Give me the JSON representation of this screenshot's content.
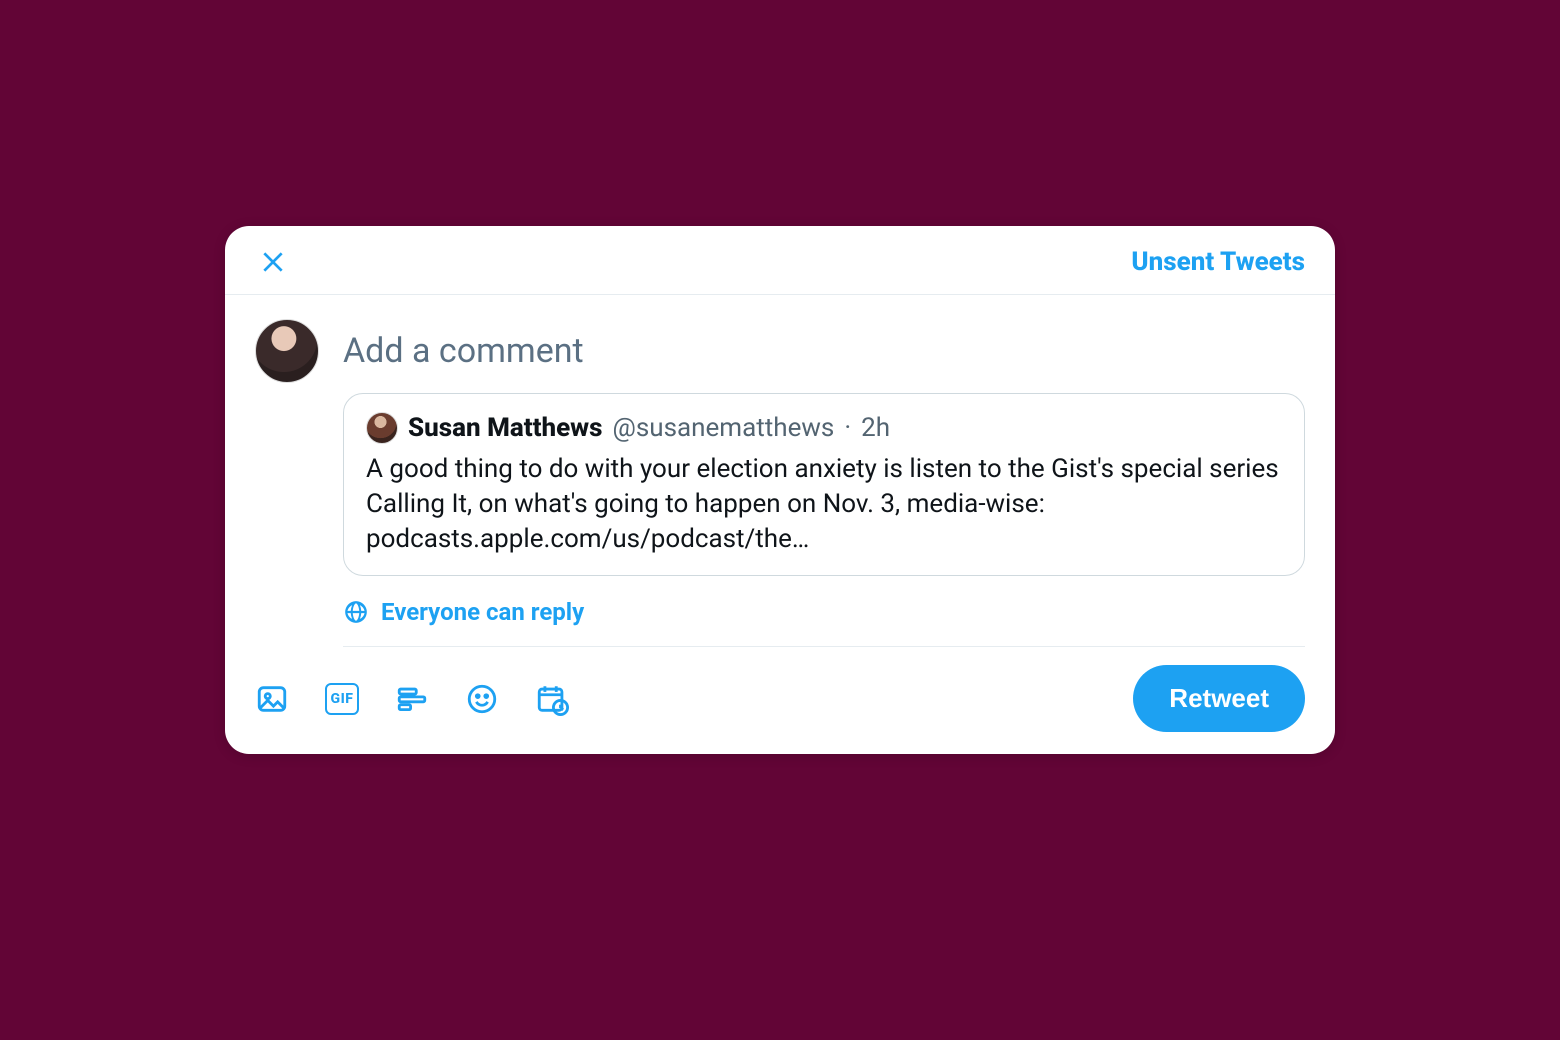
{
  "header": {
    "unsent_label": "Unsent Tweets"
  },
  "compose": {
    "placeholder": "Add a comment"
  },
  "quoted": {
    "name": "Susan Matthews",
    "handle": "@susanematthews",
    "separator": "·",
    "time": "2h",
    "text": "A good thing to do with your election anxiety is listen to the Gist's special series Calling It, on what's going to happen on Nov. 3, media-wise: podcasts.apple.com/us/podcast/the…"
  },
  "reply_setting": {
    "label": "Everyone can reply"
  },
  "toolbar": {
    "gif_label": "GIF",
    "retweet_label": "Retweet"
  }
}
